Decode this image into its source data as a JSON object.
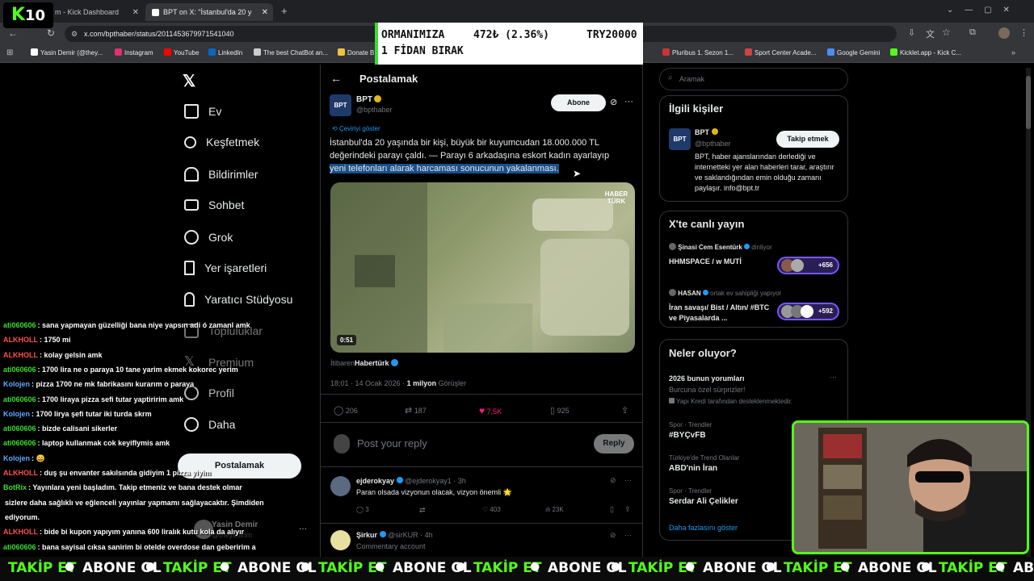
{
  "browser": {
    "tabs": [
      {
        "label": "m - Kick Dashboard"
      },
      {
        "label": "BPT on X: \"İstanbul'da 20 yaşında"
      }
    ],
    "url": "x.com/bpthaber/status/2011453679971541040",
    "bookmarks": [
      "Yasin Demir (@they...",
      "Instagram",
      "YouTube",
      "LinkedIn",
      "The best ChatBot an...",
      "Donate B",
      "Pluribus 1. Sezon 1...",
      "Sport Center Acade...",
      "Google Gemini",
      "Kicklet.app - Kick C..."
    ]
  },
  "overlay": {
    "logo_k": "K",
    "logo_num": "10",
    "ticker_line1_left": "ORMANIMIZA",
    "ticker_line1_mid": "472₺ (2.36%)",
    "ticker_line1_right": "TRY20000",
    "ticker_line2": "1 FİDAN BIRAK",
    "bottom_items": [
      "TAKİP ET",
      "ABONE OL",
      "TAKİP ET",
      "ABONE OL",
      "TAKİP ET",
      "ABONE OL",
      "TAKİP ET",
      "ABONE OL",
      "TAKİP ET",
      "ABONE OL",
      "TAKİP ET",
      "ABONE OL",
      "TAKİP ET",
      "ABONE OL"
    ]
  },
  "nav": {
    "items": [
      "Ev",
      "Keşfetmek",
      "Bildirimler",
      "Sohbet",
      "Grok",
      "Yer işaretleri",
      "Yaratıcı Stüdyosu",
      "Topluluklar",
      "Premium",
      "Profil",
      "Daha"
    ],
    "post_button": "Postalamak",
    "user_name": "Yasin Demir",
    "user_handle": "@theyasinm"
  },
  "post": {
    "header_title": "Postalamak",
    "author_name": "BPT",
    "author_handle": "@bpthaber",
    "subscribe_label": "Abone",
    "translate_label": "Çeviriyi göster",
    "text_line1": "İstanbul'da 20 yaşında bir kişi, büyük bir kuyumcudan 18.000.000 TL",
    "text_line2": "değerindeki parayı çaldı. — Parayı 6 arkadaşına eskort kadın ayarlayıp",
    "text_line3": "yeni telefonları alarak harcaması sonucunun yakalanması.",
    "video_duration": "0:51",
    "video_watermark": "HABER TÜRK",
    "source_prefix": "İtibaren",
    "source_name": "Habertürk",
    "timestamp": "18:01 · 14 Ocak 2026 · ",
    "views_count": "1 milyon",
    "views_label": " Görüşler",
    "replies": "206",
    "reposts": "187",
    "likes": "7,5K",
    "bookmarks": "925",
    "reply_placeholder": "Post your reply",
    "reply_button": "Reply"
  },
  "replies": [
    {
      "name": "ejderokyay",
      "handle": "@ejderokyay1 · 3h",
      "text": "Paran olsada vizyonun olacak, vizyon önemli 🌟",
      "replies": "3",
      "likes": "403",
      "views": "23K"
    },
    {
      "name": "Şirkur",
      "handle": "@sirKUR · 4h",
      "text": "Commentary account"
    }
  ],
  "sidebar": {
    "search_placeholder": "Aramak",
    "related_title": "İlgili kişiler",
    "related_name": "BPT",
    "related_handle": "@bpthaber",
    "follow_label": "Takip etmek",
    "related_bio": "BPT, haber ajanslarından derlediği ve internetteki yer alan haberleri tarar, araştırır ve saklandığından emin olduğu zamanı paylaşır. info@bpt.tr",
    "live_title": "X'te canlı yayın",
    "live": [
      {
        "host": "Şinasi Cem Esentürk",
        "role": " dinliyor",
        "title": "HHMSPACE / w MUTİ",
        "count": "+656"
      },
      {
        "host": "HASAN",
        "role": " ortak ev sahipliği yapıyor",
        "title": "İran savaşı/ Bist / Altın/ #BTC ve Piyasalarda ...",
        "count": "+592"
      }
    ],
    "trends_title": "Neler oluyor?",
    "trends": [
      {
        "category": "",
        "name": "2026 bunun yorumları",
        "sub": "Burcuna özel sürprizler!",
        "note": "Yapı Kredi tarafından desteklenmektedir."
      },
      {
        "category": "Spor · Trendler",
        "name": "#BYÇvFB"
      },
      {
        "category": "Türkiye'de Trend Olanlar",
        "name": "ABD'nin İran"
      },
      {
        "category": "Spor · Trendler",
        "name": "Serdar Ali Çelikler"
      }
    ],
    "show_more": "Daha fazlasını göster"
  },
  "chat": [
    {
      "user": "ati060606",
      "msg": ": sana yapmayan güzelliği bana niye yapsın adi ó zamanl amk",
      "color": "g"
    },
    {
      "user": "ALKHOLL",
      "msg": ": 1750 mi",
      "color": "r"
    },
    {
      "user": "ALKHOLL",
      "msg": ": kolay gelsin amk",
      "color": "r"
    },
    {
      "user": "ati060606",
      "msg": ": 1700 lira ne o paraya 10 tane yarim ekmek kokorec yerim",
      "color": "g"
    },
    {
      "user": "Kolojen",
      "msg": ": pizza 1700 ne mk fabrikasını kurarım o paraya",
      "color": "b"
    },
    {
      "user": "ati060606",
      "msg": ": 1700 liraya pizza sefi tutar yaptiririm amk",
      "color": "g"
    },
    {
      "user": "Kolojen",
      "msg": ": 1700 lirya şefi tutar iki turda skrm",
      "color": "b"
    },
    {
      "user": "ati060606",
      "msg": ": bizde calisani sikerler",
      "color": "g"
    },
    {
      "user": "ati060606",
      "msg": ": laptop kullanmak cok keyiflymis amk",
      "color": "g"
    },
    {
      "user": "Kolojen",
      "msg": ": 😄",
      "color": "b"
    },
    {
      "user": "ALKHOLL",
      "msg": ": duş şu envanter sakılsında gidiyim 1 pizza yiyim",
      "color": "r"
    },
    {
      "user": "BotRix",
      "msg": ": Yayınlara yeni başladım. Takip etmeniz ve bana destek olmar",
      "color": "g"
    },
    {
      "user": "",
      "msg": "sizlere daha sağlıklı ve eğlenceli yayınlar yapmamı sağlayacaktır. Şimdiden",
      "color": "g"
    },
    {
      "user": "",
      "msg": "ediyorum.",
      "color": "g"
    },
    {
      "user": "ALKHOLL",
      "msg": ": bide bi kupon yapıyım yanına 600 liralık kutu kola da alıyır",
      "color": "r"
    },
    {
      "user": "ati060606",
      "msg": ": bana sayisal cıksa sanirim bi otelde overdose dan geberirim a",
      "color": "g"
    }
  ]
}
